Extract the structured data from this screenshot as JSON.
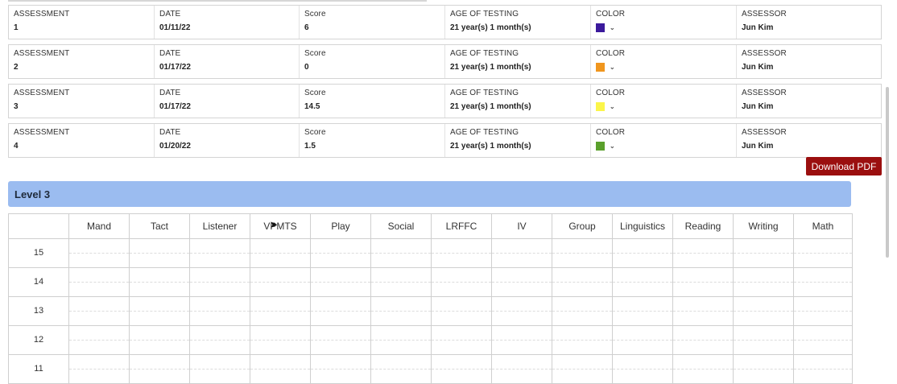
{
  "assessments": [
    {
      "assessment_label": "ASSESSMENT",
      "assessment": "1",
      "date_label": "DATE",
      "date": "01/11/22",
      "score_label": "Score",
      "score": "6",
      "age_label": "AGE OF TESTING",
      "age": "21 year(s) 1 month(s)",
      "color_label": "COLOR",
      "color": "#3b1a9c",
      "assessor_label": "ASSESSOR",
      "assessor": "Jun Kim"
    },
    {
      "assessment_label": "ASSESSMENT",
      "assessment": "2",
      "date_label": "DATE",
      "date": "01/17/22",
      "score_label": "Score",
      "score": "0",
      "age_label": "AGE OF TESTING",
      "age": "21 year(s) 1 month(s)",
      "color_label": "COLOR",
      "color": "#f0961e",
      "assessor_label": "ASSESSOR",
      "assessor": "Jun Kim"
    },
    {
      "assessment_label": "ASSESSMENT",
      "assessment": "3",
      "date_label": "DATE",
      "date": "01/17/22",
      "score_label": "Score",
      "score": "14.5",
      "age_label": "AGE OF TESTING",
      "age": "21 year(s) 1 month(s)",
      "color_label": "COLOR",
      "color": "#fbf54a",
      "assessor_label": "ASSESSOR",
      "assessor": "Jun Kim"
    },
    {
      "assessment_label": "ASSESSMENT",
      "assessment": "4",
      "date_label": "DATE",
      "date": "01/20/22",
      "score_label": "Score",
      "score": "1.5",
      "age_label": "AGE OF TESTING",
      "age": "21 year(s) 1 month(s)",
      "color_label": "COLOR",
      "color": "#5aa02c",
      "assessor_label": "ASSESSOR",
      "assessor": "Jun Kim"
    }
  ],
  "chevron_glyph": "⌄",
  "download_button": "Download PDF",
  "level": {
    "title": "Level 3"
  },
  "grid": {
    "columns": [
      "Mand",
      "Tact",
      "Listener",
      "VPMTS",
      "Play",
      "Social",
      "LRFFC",
      "IV",
      "Group",
      "Linguistics",
      "Reading",
      "Writing",
      "Math"
    ],
    "rows": [
      "15",
      "14",
      "13",
      "12",
      "11"
    ]
  },
  "cursor_glyph": "➤"
}
